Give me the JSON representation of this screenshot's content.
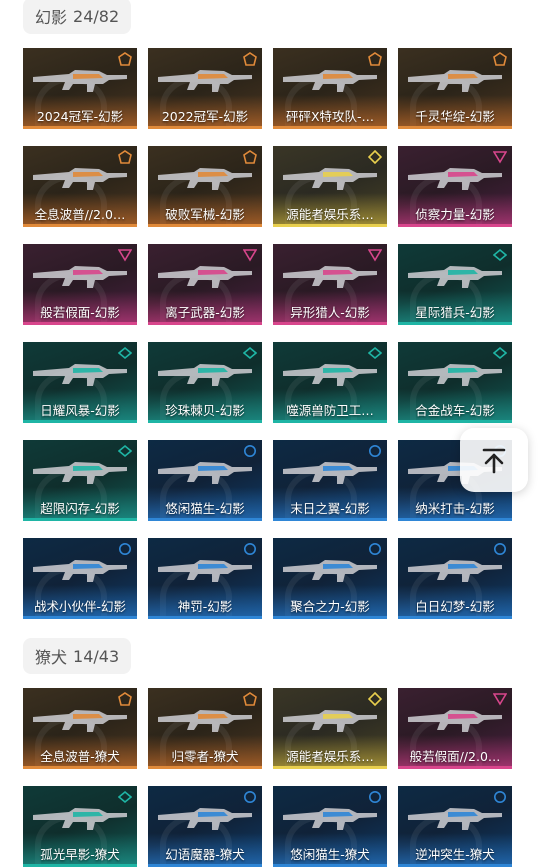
{
  "colors": {
    "ultra": "#e08a3a",
    "exclusive": "#e8cf4e",
    "premium": "#d8468c",
    "deluxe": "#1fb5a5",
    "select": "#2f86d6"
  },
  "sections": [
    {
      "title": "幻影",
      "count": "24/82",
      "items": [
        {
          "label": "2024冠军-幻影",
          "tier": "ultra",
          "icon": "ultra-tier-icon"
        },
        {
          "label": "2022冠军-幻影",
          "tier": "ultra",
          "icon": "ultra-tier-icon"
        },
        {
          "label": "砰砰X特攻队-…",
          "tier": "ultra",
          "icon": "ultra-tier-icon"
        },
        {
          "label": "千灵华绽-幻影",
          "tier": "ultra",
          "icon": "ultra-tier-icon"
        },
        {
          "label": "全息波普//2.0…",
          "tier": "ultra",
          "icon": "ultra-tier-icon"
        },
        {
          "label": "破败军械-幻影",
          "tier": "ultra",
          "icon": "ultra-tier-icon"
        },
        {
          "label": "源能者娱乐系…",
          "tier": "excl",
          "icon": "exclusive-tier-icon"
        },
        {
          "label": "侦察力量-幻影",
          "tier": "prem",
          "icon": "premium-tier-icon"
        },
        {
          "label": "般若假面-幻影",
          "tier": "prem",
          "icon": "premium-tier-icon"
        },
        {
          "label": "离子武器-幻影",
          "tier": "prem",
          "icon": "premium-tier-icon"
        },
        {
          "label": "异形猎人-幻影",
          "tier": "prem",
          "icon": "premium-tier-icon"
        },
        {
          "label": "星际猎兵-幻影",
          "tier": "del",
          "icon": "deluxe-tier-icon"
        },
        {
          "label": "日耀风暴-幻影",
          "tier": "del",
          "icon": "deluxe-tier-icon"
        },
        {
          "label": "珍珠棘贝-幻影",
          "tier": "del",
          "icon": "deluxe-tier-icon"
        },
        {
          "label": "噬源兽防卫工…",
          "tier": "del",
          "icon": "deluxe-tier-icon"
        },
        {
          "label": "合金战车-幻影",
          "tier": "del",
          "icon": "deluxe-tier-icon"
        },
        {
          "label": "超限闪存-幻影",
          "tier": "del",
          "icon": "deluxe-tier-icon"
        },
        {
          "label": "悠闲猫生-幻影",
          "tier": "sel",
          "icon": "select-tier-icon"
        },
        {
          "label": "末日之翼-幻影",
          "tier": "sel",
          "icon": "select-tier-icon"
        },
        {
          "label": "纳米打击-幻影",
          "tier": "sel",
          "icon": "select-tier-icon"
        },
        {
          "label": "战术小伙伴-幻影",
          "tier": "sel",
          "icon": "select-tier-icon"
        },
        {
          "label": "神罚-幻影",
          "tier": "sel",
          "icon": "select-tier-icon"
        },
        {
          "label": "聚合之力-幻影",
          "tier": "sel",
          "icon": "select-tier-icon"
        },
        {
          "label": "白日幻梦-幻影",
          "tier": "sel",
          "icon": "select-tier-icon"
        }
      ]
    },
    {
      "title": "獠犬",
      "count": "14/43",
      "items": [
        {
          "label": "全息波普-獠犬",
          "tier": "ultra",
          "icon": "ultra-tier-icon"
        },
        {
          "label": "归零者-獠犬",
          "tier": "ultra",
          "icon": "ultra-tier-icon"
        },
        {
          "label": "源能者娱乐系…",
          "tier": "excl",
          "icon": "exclusive-tier-icon"
        },
        {
          "label": "般若假面//2.0…",
          "tier": "prem",
          "icon": "premium-tier-icon"
        },
        {
          "label": "孤光早影-獠犬",
          "tier": "del",
          "icon": "deluxe-tier-icon"
        },
        {
          "label": "幻语魔器-獠犬",
          "tier": "sel",
          "icon": "select-tier-icon"
        },
        {
          "label": "悠闲猫生-獠犬",
          "tier": "sel",
          "icon": "select-tier-icon"
        },
        {
          "label": "逆冲突生-獠犬",
          "tier": "sel",
          "icon": "select-tier-icon"
        }
      ]
    }
  ],
  "back_to_top": {
    "icon": "arrow-up-to-top-icon"
  }
}
